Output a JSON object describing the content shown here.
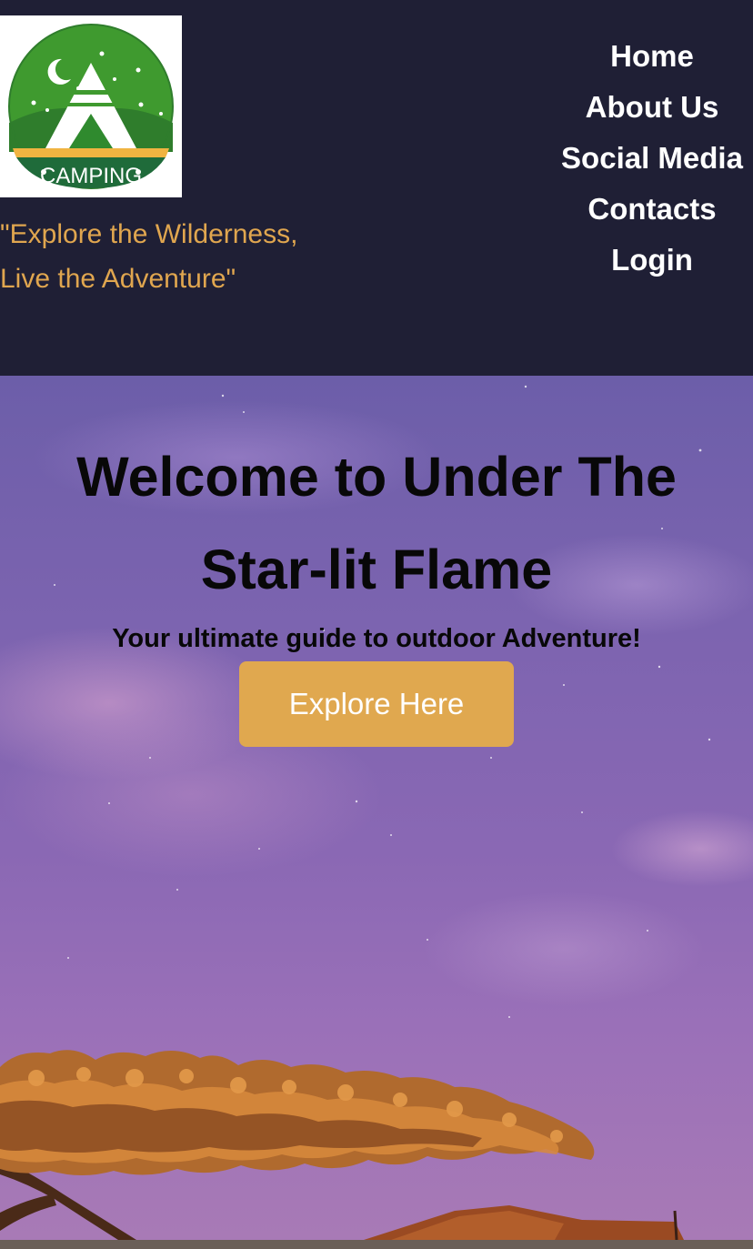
{
  "header": {
    "logo": {
      "text": "CAMPING",
      "icon": "camping-tent-logo",
      "colors": {
        "green": "#3f9a2f",
        "dark_green": "#1f6b3a",
        "band": "#f0b441"
      }
    },
    "tagline_line1": "\"Explore the Wilderness,",
    "tagline_line2": "Live the Adventure\""
  },
  "nav": {
    "items": [
      {
        "label": "Home"
      },
      {
        "label": "About Us"
      },
      {
        "label": "Social Media"
      },
      {
        "label": "Contacts"
      },
      {
        "label": "Login"
      }
    ]
  },
  "hero": {
    "title_line1": "Welcome to Under The",
    "title_line2": "Star-lit Flame",
    "subtitle": "Your ultimate guide to outdoor Adventure!",
    "cta_label": "Explore Here"
  },
  "colors": {
    "header_bg": "#1f1f35",
    "accent": "#e0a84f",
    "nav_text": "#ffffff",
    "hero_text": "#080808"
  }
}
